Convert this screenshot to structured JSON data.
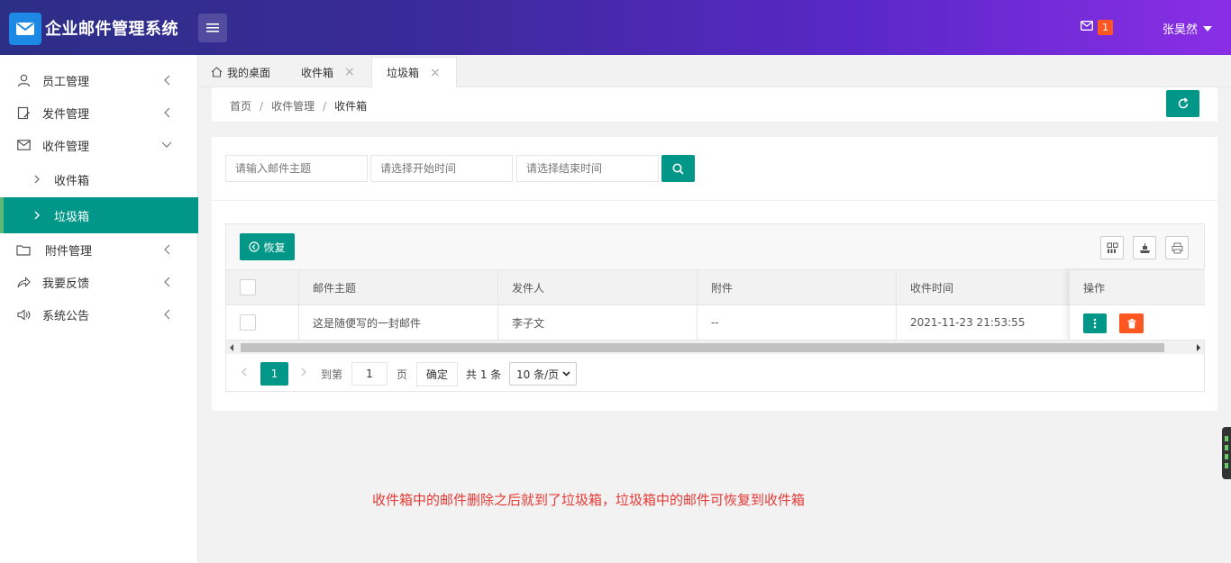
{
  "header": {
    "app_title": "企业邮件管理系统",
    "mail_badge": "1",
    "username": "张昊然"
  },
  "sidebar": {
    "items": [
      {
        "label": "员工管理",
        "icon": "user-icon"
      },
      {
        "label": "发件管理",
        "icon": "compose-icon"
      },
      {
        "label": "收件管理",
        "icon": "mail-icon"
      },
      {
        "label": "收件箱",
        "icon": "chevron-right-icon"
      },
      {
        "label": "垃圾箱",
        "icon": "chevron-right-icon",
        "active": true
      },
      {
        "label": "附件管理",
        "icon": "folder-icon"
      },
      {
        "label": "我要反馈",
        "icon": "share-icon"
      },
      {
        "label": "系统公告",
        "icon": "speaker-icon"
      }
    ]
  },
  "tabs": [
    {
      "label": "我的桌面",
      "icon": "home-icon"
    },
    {
      "label": "收件箱",
      "closable": true
    },
    {
      "label": "垃圾箱",
      "closable": true,
      "active": true
    }
  ],
  "breadcrumb": [
    "首页",
    "收件管理",
    "收件箱"
  ],
  "search": {
    "subject_placeholder": "请输入邮件主题",
    "start_placeholder": "请选择开始时间",
    "end_placeholder": "请选择结束时间"
  },
  "toolbar": {
    "restore_label": "恢复"
  },
  "table": {
    "columns": [
      "邮件主题",
      "发件人",
      "附件",
      "收件时间",
      "操作"
    ],
    "rows": [
      {
        "subject": "这是随便写的一封邮件",
        "sender": "李子文",
        "attachment": "--",
        "time": "2021-11-23 21:53:55"
      }
    ]
  },
  "pager": {
    "current": "1",
    "goto_label": "到第",
    "goto_value": "1",
    "page_label": "页",
    "confirm_label": "确定",
    "total": "共 1 条",
    "page_size": "10 条/页"
  },
  "note": "收件箱中的邮件删除之后就到了垃圾箱，垃圾箱中的邮件可恢复到收件箱",
  "colors": {
    "primary": "#009688",
    "danger": "#ff5722",
    "note": "#e53935"
  }
}
